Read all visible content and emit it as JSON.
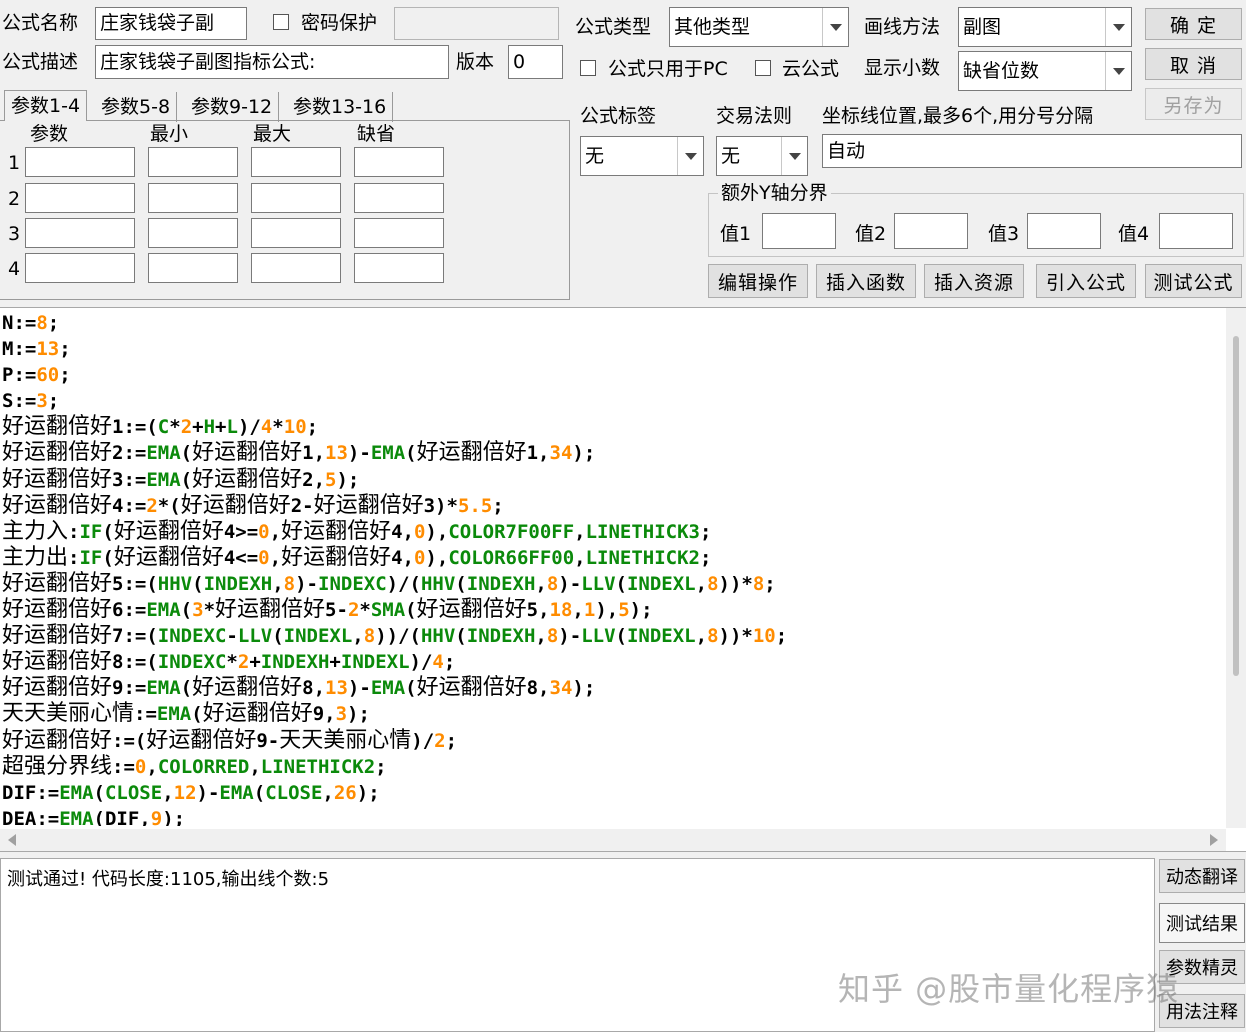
{
  "header": {
    "name_label": "公式名称",
    "name_value": "庄家钱袋子副",
    "password_label": "密码保护",
    "desc_label": "公式描述",
    "desc_value": "庄家钱袋子副图指标公式:",
    "version_label": "版本",
    "version_value": "0",
    "type_label": "公式类型",
    "type_value": "其他类型",
    "draw_label": "画线方法",
    "draw_value": "副图",
    "pc_only_label": "公式只用于PC",
    "cloud_label": "云公式",
    "decimals_label": "显示小数",
    "decimals_value": "缺省位数"
  },
  "buttons": {
    "ok": "确  定",
    "cancel": "取  消",
    "save_as": "另存为",
    "edit": "编辑操作",
    "insert_fn": "插入函数",
    "insert_res": "插入资源",
    "import": "引入公式",
    "test": "测试公式",
    "side": [
      "动态翻译",
      "测试结果",
      "参数精灵",
      "用法注释"
    ]
  },
  "params": {
    "tabs": [
      "参数1-4",
      "参数5-8",
      "参数9-12",
      "参数13-16"
    ],
    "columns": [
      "参数",
      "最小",
      "最大",
      "缺省"
    ],
    "rows": [
      "1",
      "2",
      "3",
      "4"
    ]
  },
  "settings": {
    "tag_label": "公式标签",
    "tag_value": "无",
    "rule_label": "交易法则",
    "rule_value": "无",
    "coord_label": "坐标线位置,最多6个,用分号分隔",
    "coord_value": "自动",
    "yaxis_label": "额外Y轴分界",
    "value_labels": [
      "值1",
      "值2",
      "值3",
      "值4"
    ]
  },
  "code_lines": [
    [
      [
        "t",
        "N:="
      ],
      [
        "n",
        "8"
      ],
      [
        "t",
        ";"
      ]
    ],
    [
      [
        "t",
        "M:="
      ],
      [
        "n",
        "13"
      ],
      [
        "t",
        ";"
      ]
    ],
    [
      [
        "t",
        "P:="
      ],
      [
        "n",
        "60"
      ],
      [
        "t",
        ";"
      ]
    ],
    [
      [
        "t",
        "S:="
      ],
      [
        "n",
        "3"
      ],
      [
        "t",
        ";"
      ]
    ],
    [
      [
        "c",
        "好运翻倍好"
      ],
      [
        "t",
        "1:=("
      ],
      [
        "f",
        "C"
      ],
      [
        "t",
        "*"
      ],
      [
        "n",
        "2"
      ],
      [
        "t",
        "+"
      ],
      [
        "f",
        "H"
      ],
      [
        "t",
        "+"
      ],
      [
        "f",
        "L"
      ],
      [
        "t",
        ")/"
      ],
      [
        "n",
        "4"
      ],
      [
        "t",
        "*"
      ],
      [
        "n",
        "10"
      ],
      [
        "t",
        ";"
      ]
    ],
    [
      [
        "c",
        "好运翻倍好"
      ],
      [
        "t",
        "2:="
      ],
      [
        "f",
        "EMA"
      ],
      [
        "t",
        "("
      ],
      [
        "c",
        "好运翻倍好"
      ],
      [
        "t",
        "1,"
      ],
      [
        "n",
        "13"
      ],
      [
        "t",
        ")-"
      ],
      [
        "f",
        "EMA"
      ],
      [
        "t",
        "("
      ],
      [
        "c",
        "好运翻倍好"
      ],
      [
        "t",
        "1,"
      ],
      [
        "n",
        "34"
      ],
      [
        "t",
        ");"
      ]
    ],
    [
      [
        "c",
        "好运翻倍好"
      ],
      [
        "t",
        "3:="
      ],
      [
        "f",
        "EMA"
      ],
      [
        "t",
        "("
      ],
      [
        "c",
        "好运翻倍好"
      ],
      [
        "t",
        "2,"
      ],
      [
        "n",
        "5"
      ],
      [
        "t",
        ");"
      ]
    ],
    [
      [
        "c",
        "好运翻倍好"
      ],
      [
        "t",
        "4:="
      ],
      [
        "n",
        "2"
      ],
      [
        "t",
        "*("
      ],
      [
        "c",
        "好运翻倍好"
      ],
      [
        "t",
        "2-"
      ],
      [
        "c",
        "好运翻倍好"
      ],
      [
        "t",
        "3)*"
      ],
      [
        "n",
        "5.5"
      ],
      [
        "t",
        ";"
      ]
    ],
    [
      [
        "c",
        "主力入"
      ],
      [
        "t",
        ":"
      ],
      [
        "f",
        "IF"
      ],
      [
        "t",
        "("
      ],
      [
        "c",
        "好运翻倍好"
      ],
      [
        "t",
        "4>="
      ],
      [
        "n",
        "0"
      ],
      [
        "t",
        ","
      ],
      [
        "c",
        "好运翻倍好"
      ],
      [
        "t",
        "4,"
      ],
      [
        "n",
        "0"
      ],
      [
        "t",
        "),"
      ],
      [
        "f",
        "COLOR7F00FF"
      ],
      [
        "t",
        ","
      ],
      [
        "f",
        "LINETHICK3"
      ],
      [
        "t",
        ";"
      ]
    ],
    [
      [
        "c",
        "主力出"
      ],
      [
        "t",
        ":"
      ],
      [
        "f",
        "IF"
      ],
      [
        "t",
        "("
      ],
      [
        "c",
        "好运翻倍好"
      ],
      [
        "t",
        "4<="
      ],
      [
        "n",
        "0"
      ],
      [
        "t",
        ","
      ],
      [
        "c",
        "好运翻倍好"
      ],
      [
        "t",
        "4,"
      ],
      [
        "n",
        "0"
      ],
      [
        "t",
        "),"
      ],
      [
        "f",
        "COLOR66FF00"
      ],
      [
        "t",
        ","
      ],
      [
        "f",
        "LINETHICK2"
      ],
      [
        "t",
        ";"
      ]
    ],
    [
      [
        "c",
        "好运翻倍好"
      ],
      [
        "t",
        "5:=("
      ],
      [
        "f",
        "HHV"
      ],
      [
        "t",
        "("
      ],
      [
        "f",
        "INDEXH"
      ],
      [
        "t",
        ","
      ],
      [
        "n",
        "8"
      ],
      [
        "t",
        ")-"
      ],
      [
        "f",
        "INDEXC"
      ],
      [
        "t",
        ")/("
      ],
      [
        "f",
        "HHV"
      ],
      [
        "t",
        "("
      ],
      [
        "f",
        "INDEXH"
      ],
      [
        "t",
        ","
      ],
      [
        "n",
        "8"
      ],
      [
        "t",
        ")-"
      ],
      [
        "f",
        "LLV"
      ],
      [
        "t",
        "("
      ],
      [
        "f",
        "INDEXL"
      ],
      [
        "t",
        ","
      ],
      [
        "n",
        "8"
      ],
      [
        "t",
        "))*"
      ],
      [
        "n",
        "8"
      ],
      [
        "t",
        ";"
      ]
    ],
    [
      [
        "c",
        "好运翻倍好"
      ],
      [
        "t",
        "6:="
      ],
      [
        "f",
        "EMA"
      ],
      [
        "t",
        "("
      ],
      [
        "n",
        "3"
      ],
      [
        "t",
        "*"
      ],
      [
        "c",
        "好运翻倍好"
      ],
      [
        "t",
        "5-"
      ],
      [
        "n",
        "2"
      ],
      [
        "t",
        "*"
      ],
      [
        "f",
        "SMA"
      ],
      [
        "t",
        "("
      ],
      [
        "c",
        "好运翻倍好"
      ],
      [
        "t",
        "5,"
      ],
      [
        "n",
        "18"
      ],
      [
        "t",
        ","
      ],
      [
        "n",
        "1"
      ],
      [
        "t",
        "),"
      ],
      [
        "n",
        "5"
      ],
      [
        "t",
        ");"
      ]
    ],
    [
      [
        "c",
        "好运翻倍好"
      ],
      [
        "t",
        "7:=("
      ],
      [
        "f",
        "INDEXC"
      ],
      [
        "t",
        "-"
      ],
      [
        "f",
        "LLV"
      ],
      [
        "t",
        "("
      ],
      [
        "f",
        "INDEXL"
      ],
      [
        "t",
        ","
      ],
      [
        "n",
        "8"
      ],
      [
        "t",
        "))/("
      ],
      [
        "f",
        "HHV"
      ],
      [
        "t",
        "("
      ],
      [
        "f",
        "INDEXH"
      ],
      [
        "t",
        ","
      ],
      [
        "n",
        "8"
      ],
      [
        "t",
        ")-"
      ],
      [
        "f",
        "LLV"
      ],
      [
        "t",
        "("
      ],
      [
        "f",
        "INDEXL"
      ],
      [
        "t",
        ","
      ],
      [
        "n",
        "8"
      ],
      [
        "t",
        "))*"
      ],
      [
        "n",
        "10"
      ],
      [
        "t",
        ";"
      ]
    ],
    [
      [
        "c",
        "好运翻倍好"
      ],
      [
        "t",
        "8:=("
      ],
      [
        "f",
        "INDEXC"
      ],
      [
        "t",
        "*"
      ],
      [
        "n",
        "2"
      ],
      [
        "t",
        "+"
      ],
      [
        "f",
        "INDEXH"
      ],
      [
        "t",
        "+"
      ],
      [
        "f",
        "INDEXL"
      ],
      [
        "t",
        ")/"
      ],
      [
        "n",
        "4"
      ],
      [
        "t",
        ";"
      ]
    ],
    [
      [
        "c",
        "好运翻倍好"
      ],
      [
        "t",
        "9:="
      ],
      [
        "f",
        "EMA"
      ],
      [
        "t",
        "("
      ],
      [
        "c",
        "好运翻倍好"
      ],
      [
        "t",
        "8,"
      ],
      [
        "n",
        "13"
      ],
      [
        "t",
        ")-"
      ],
      [
        "f",
        "EMA"
      ],
      [
        "t",
        "("
      ],
      [
        "c",
        "好运翻倍好"
      ],
      [
        "t",
        "8,"
      ],
      [
        "n",
        "34"
      ],
      [
        "t",
        ");"
      ]
    ],
    [
      [
        "c",
        "天天美丽心情"
      ],
      [
        "t",
        ":="
      ],
      [
        "f",
        "EMA"
      ],
      [
        "t",
        "("
      ],
      [
        "c",
        "好运翻倍好"
      ],
      [
        "t",
        "9,"
      ],
      [
        "n",
        "3"
      ],
      [
        "t",
        ");"
      ]
    ],
    [
      [
        "c",
        "好运翻倍好"
      ],
      [
        "t",
        ":=("
      ],
      [
        "c",
        "好运翻倍好"
      ],
      [
        "t",
        "9-"
      ],
      [
        "c",
        "天天美丽心情"
      ],
      [
        "t",
        ")/"
      ],
      [
        "n",
        "2"
      ],
      [
        "t",
        ";"
      ]
    ],
    [
      [
        "c",
        "超强分界线"
      ],
      [
        "t",
        ":="
      ],
      [
        "n",
        "0"
      ],
      [
        "t",
        ","
      ],
      [
        "f",
        "COLORRED"
      ],
      [
        "t",
        ","
      ],
      [
        "f",
        "LINETHICK2"
      ],
      [
        "t",
        ";"
      ]
    ],
    [
      [
        "t",
        "DIF:="
      ],
      [
        "f",
        "EMA"
      ],
      [
        "t",
        "("
      ],
      [
        "f",
        "CLOSE"
      ],
      [
        "t",
        ","
      ],
      [
        "n",
        "12"
      ],
      [
        "t",
        ")-"
      ],
      [
        "f",
        "EMA"
      ],
      [
        "t",
        "("
      ],
      [
        "f",
        "CLOSE"
      ],
      [
        "t",
        ","
      ],
      [
        "n",
        "26"
      ],
      [
        "t",
        ");"
      ]
    ],
    [
      [
        "t",
        "DEA:="
      ],
      [
        "f",
        "EMA"
      ],
      [
        "t",
        "(DIF,"
      ],
      [
        "n",
        "9"
      ],
      [
        "t",
        ");"
      ]
    ]
  ],
  "output_text": "测试通过! 代码长度:1105,输出线个数:5",
  "watermark": "知乎 @股市量化程序猿",
  "colors": {
    "number": "#ff8c00",
    "function": "#0b8a0b"
  }
}
